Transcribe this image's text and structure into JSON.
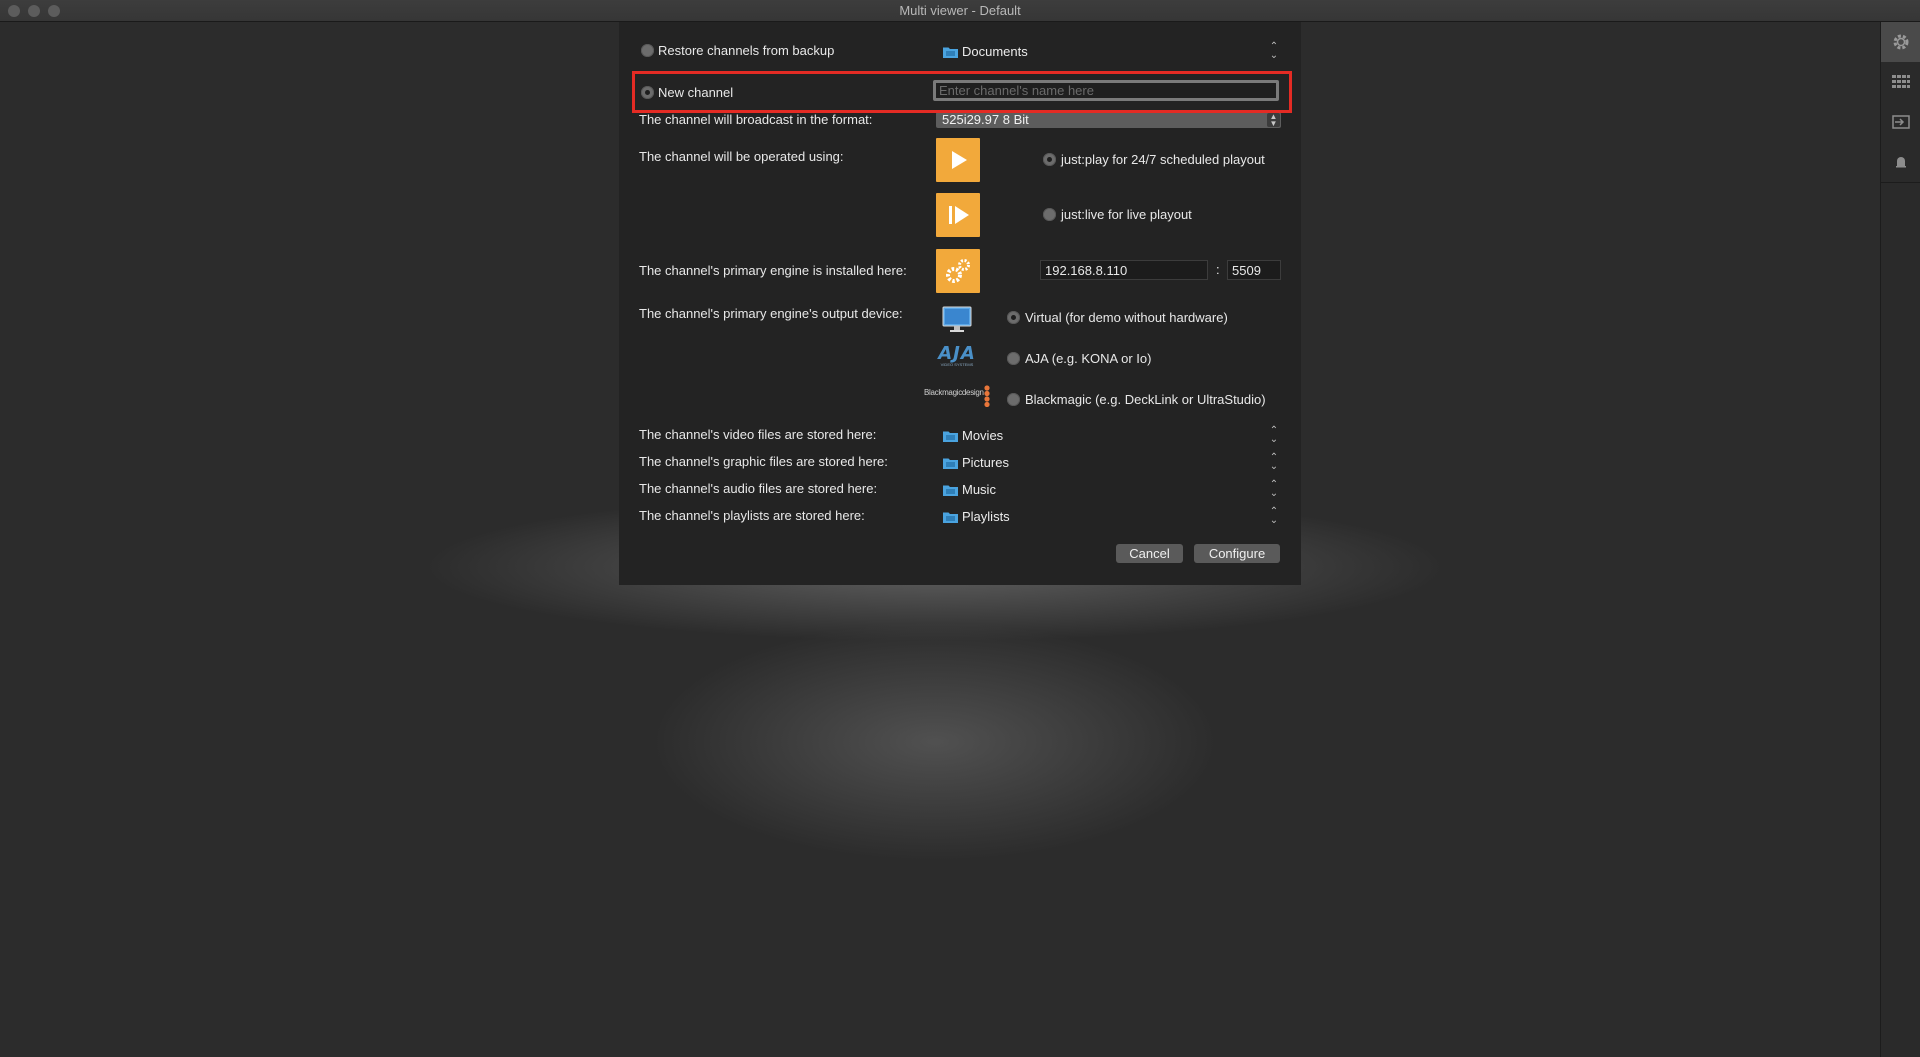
{
  "window": {
    "title": "Multi viewer - Default"
  },
  "dialog": {
    "restore": {
      "label": "Restore channels from backup",
      "location": "Documents"
    },
    "new_channel": {
      "label": "New channel",
      "name_placeholder": "Enter channel's name here",
      "name_value": ""
    },
    "format": {
      "label": "The channel will broadcast in the format:",
      "value": "525i29.97 8 Bit"
    },
    "operated": {
      "label": "The channel will be operated using:",
      "options": [
        {
          "label": "just:play for 24/7 scheduled playout",
          "selected": true,
          "icon": "play-icon"
        },
        {
          "label": "just:live for live playout",
          "selected": false,
          "icon": "live-icon"
        }
      ]
    },
    "engine": {
      "label": "The channel's primary engine is installed here:",
      "host": "192.168.8.110",
      "separator": ":",
      "port": "5509",
      "icon": "gears-icon"
    },
    "output": {
      "label": "The channel's primary engine's output device:",
      "options": [
        {
          "label": "Virtual (for demo without hardware)",
          "selected": true,
          "icon": "monitor-icon"
        },
        {
          "label": "AJA (e.g. KONA or Io)",
          "selected": false,
          "icon": "aja-logo",
          "logo_text": "AJA",
          "logo_subtext": "VIDEO SYSTEMS"
        },
        {
          "label": "Blackmagic (e.g. DeckLink or UltraStudio)",
          "selected": false,
          "icon": "blackmagic-logo",
          "logo_text": "Blackmagicdesign"
        }
      ]
    },
    "storage": [
      {
        "label": "The channel's video files are stored here:",
        "value": "Movies"
      },
      {
        "label": "The channel's graphic files are stored here:",
        "value": "Pictures"
      },
      {
        "label": "The channel's audio files are stored here:",
        "value": "Music"
      },
      {
        "label": "The channel's playlists are stored here:",
        "value": "Playlists"
      }
    ],
    "buttons": {
      "cancel": "Cancel",
      "configure": "Configure"
    }
  },
  "rail": {
    "items": [
      "gear-icon",
      "grid-icon",
      "input-icon",
      "bell-icon"
    ]
  },
  "colors": {
    "accent_orange": "#f2a93b",
    "highlight_red": "#e42b24",
    "folder_blue": "#4aa3df"
  }
}
